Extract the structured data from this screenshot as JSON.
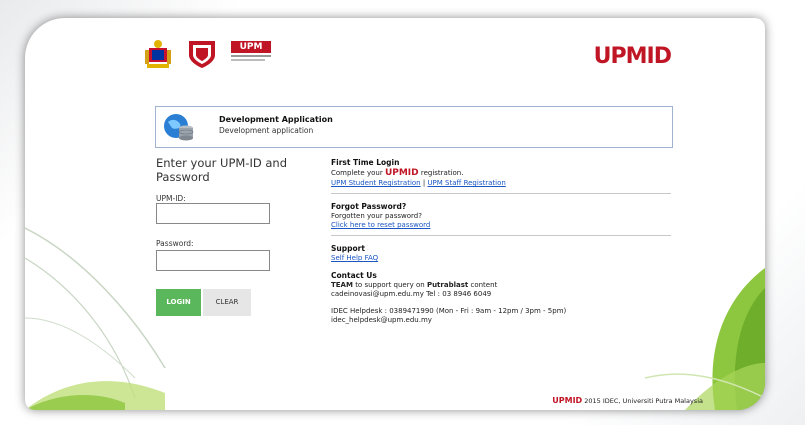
{
  "brand": {
    "name": "UPMID"
  },
  "logos": {
    "crest": "malaysia-crest",
    "upm": "UPM"
  },
  "app": {
    "title": "Development Application",
    "subtitle": "Development application"
  },
  "login": {
    "heading": "Enter your UPM-ID and Password",
    "id_label": "UPM-ID:",
    "password_label": "Password:",
    "login_button": "LOGIN",
    "clear_button": "CLEAR"
  },
  "first_time": {
    "title": "First Time Login",
    "text_prefix": "Complete your",
    "brand": "UPMID",
    "text_suffix": "registration.",
    "student_link": "UPM Student Registration",
    "separator": "|",
    "staff_link": "UPM Staff Registration"
  },
  "forgot": {
    "title": "Forgot Password?",
    "text": "Forgotten your password?",
    "link": "Click here to reset password"
  },
  "support": {
    "title": "Support",
    "link": "Self Help FAQ"
  },
  "contact": {
    "title": "Contact Us",
    "team": "TEAM",
    "line1_mid": "to support query on",
    "putrablast": "Putrablast",
    "line1_end": "content",
    "line2": "cadeinovasi@upm.edu.my Tel : 03 8946 6049",
    "line3": "IDEC Helpdesk : 0389471990 (Mon - Fri : 9am - 12pm / 3pm - 5pm)",
    "line4": "idec_helpdesk@upm.edu.my"
  },
  "footer": {
    "brand": "UPMID",
    "text": "2015 IDEC, Universiti Putra Malaysia"
  },
  "colors": {
    "brand_red": "#c01525",
    "login_green": "#5bb75b",
    "link_blue": "#1a56c4"
  }
}
